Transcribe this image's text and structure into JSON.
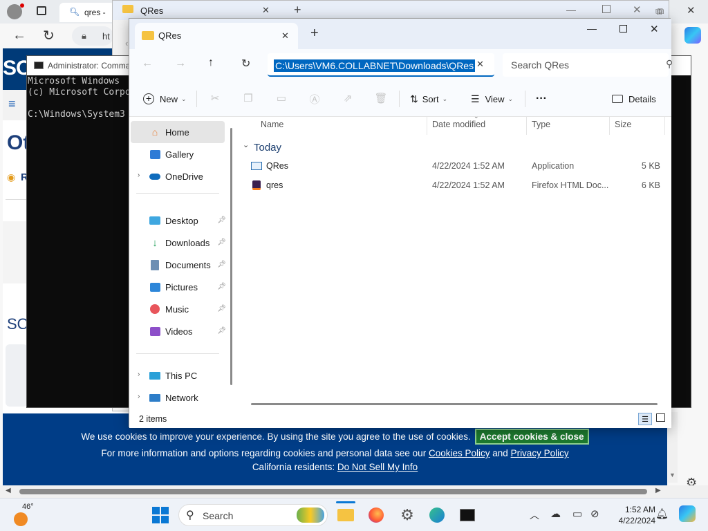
{
  "browser": {
    "tab_label": "qres -",
    "url_fragment": "ht",
    "site_logo": "SO",
    "site_fragments": [
      "Ot",
      "Ri",
      "SO"
    ],
    "cookie": {
      "line1": "We use cookies to improve your experience. By using the site you agree to the use of cookies.",
      "accept_label": "Accept cookies & close",
      "line2_prefix": "For more information and options regarding cookies and personal data see our",
      "cookies_policy": "Cookies Policy",
      "and": "and",
      "privacy_policy": "Privacy Policy",
      "line3_prefix": "California residents:",
      "do_not_sell": "Do Not Sell My Info"
    }
  },
  "cmd": {
    "title": "Administrator: Comma",
    "lines": [
      "Microsoft Windows",
      "(c) Microsoft Corpo",
      "",
      "C:\\Windows\\System3"
    ]
  },
  "back_explorer": {
    "tab_label": "QRes"
  },
  "explorer": {
    "tab_label": "QRes",
    "address": "C:\\Users\\VM6.COLLABNET\\Downloads\\QRes",
    "search_placeholder": "Search QRes",
    "toolbar": {
      "new": "New",
      "sort": "Sort",
      "view": "View",
      "more": "···",
      "details": "Details"
    },
    "nav": {
      "home": "Home",
      "gallery": "Gallery",
      "onedrive": "OneDrive",
      "desktop": "Desktop",
      "downloads": "Downloads",
      "documents": "Documents",
      "pictures": "Pictures",
      "music": "Music",
      "videos": "Videos",
      "thispc": "This PC",
      "network": "Network"
    },
    "columns": {
      "name": "Name",
      "date": "Date modified",
      "type": "Type",
      "size": "Size"
    },
    "group": "Today",
    "files": [
      {
        "name": "QRes",
        "date": "4/22/2024 1:52 AM",
        "type": "Application",
        "size": "5 KB"
      },
      {
        "name": "qres",
        "date": "4/22/2024 1:52 AM",
        "type": "Firefox HTML Doc...",
        "size": "6 KB"
      }
    ],
    "status": "2 items"
  },
  "taskbar": {
    "weather": "46°",
    "search": "Search",
    "time": "1:52 AM",
    "date": "4/22/2024"
  }
}
